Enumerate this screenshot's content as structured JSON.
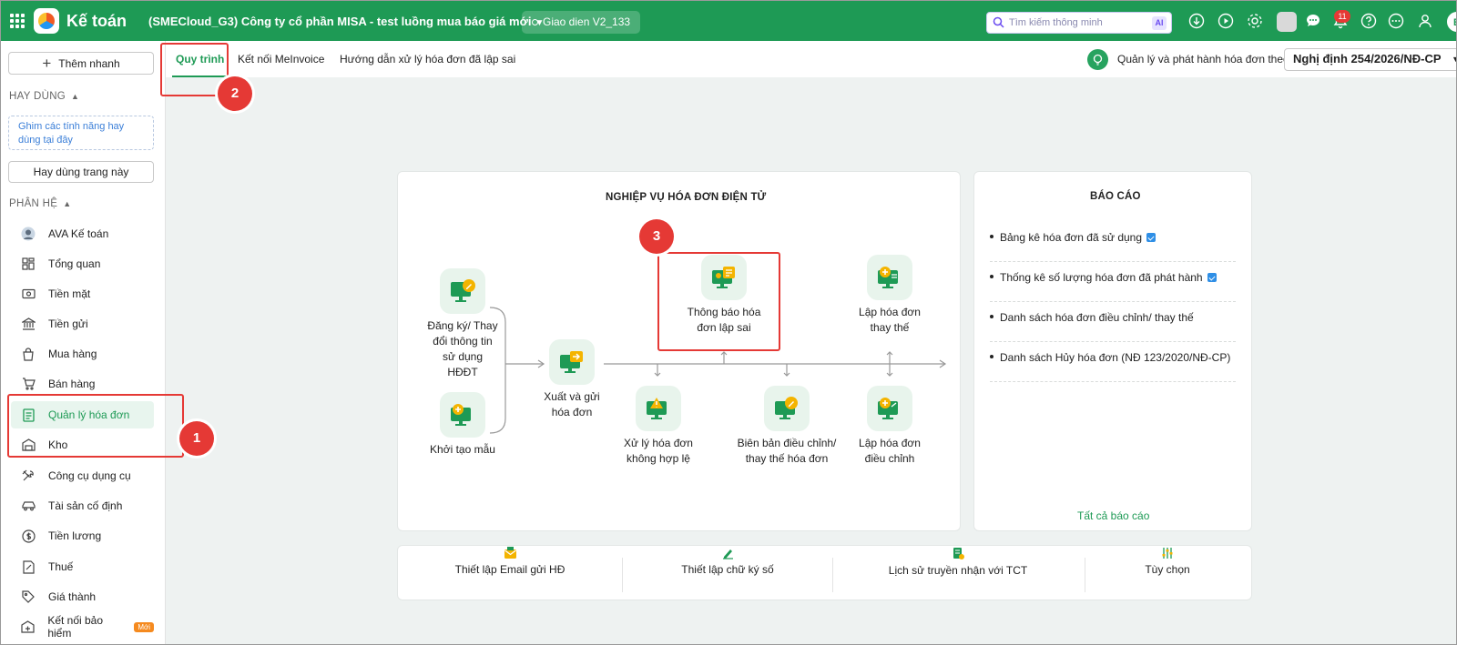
{
  "topbar": {
    "app_title": "Kế toán",
    "company": "(SMECloud_G3) Công ty cổ phần MISA - test luồng mua báo giá mới",
    "theme": "Giao dien V2_133",
    "search_placeholder": "Tìm kiếm thông minh",
    "search_ai": "AI",
    "notification_count": "11",
    "avatar_initial": "B"
  },
  "sidebar": {
    "quick_add": "Thêm nhanh",
    "frequent_title": "HAY DÙNG",
    "pin_hint": "Ghim các tính năng hay dùng tại đây",
    "frequent_button": "Hay dùng trang này",
    "modules_title": "PHÂN HỆ",
    "items": [
      {
        "label": "AVA Kế toán",
        "icon": "ava-avatar-icon"
      },
      {
        "label": "Tổng quan",
        "icon": "dashboard-icon"
      },
      {
        "label": "Tiền mặt",
        "icon": "cash-icon"
      },
      {
        "label": "Tiền gửi",
        "icon": "bank-icon"
      },
      {
        "label": "Mua hàng",
        "icon": "shopping-bag-icon"
      },
      {
        "label": "Bán hàng",
        "icon": "cart-icon"
      },
      {
        "label": "Quản lý hóa đơn",
        "icon": "invoice-icon"
      },
      {
        "label": "Kho",
        "icon": "warehouse-icon"
      },
      {
        "label": "Công cụ dụng cụ",
        "icon": "tools-icon"
      },
      {
        "label": "Tài sản cố định",
        "icon": "car-icon"
      },
      {
        "label": "Tiền lương",
        "icon": "salary-icon"
      },
      {
        "label": "Thuế",
        "icon": "tax-icon"
      },
      {
        "label": "Giá thành",
        "icon": "price-tag-icon"
      },
      {
        "label": "Kết nối bảo hiểm",
        "icon": "insurance-icon",
        "tag": "Mới"
      }
    ]
  },
  "tabs": [
    {
      "label": "Quy trình"
    },
    {
      "label": "Kết nối MeInvoice"
    },
    {
      "label": "Hướng dẫn xử lý hóa đơn đã lập sai"
    }
  ],
  "decree": {
    "label": "Quản lý và phát hành hóa đơn theo:",
    "value": "Nghị định 254/2026/NĐ-CP"
  },
  "workflow": {
    "title": "NGHIỆP VỤ HÓA ĐƠN ĐIỆN TỬ",
    "nodes": {
      "register": "Đăng ký/ Thay đổi thông tin sử dụng HĐĐT",
      "create_template": "Khởi tạo mẫu",
      "issue": "Xuất và gửi hóa đơn",
      "notify_error": "Thông báo hóa đơn lập sai",
      "handle_invalid": "Xử lý hóa đơn không hợp lệ",
      "adjust_minutes": "Biên bản điều chỉnh/ thay thế hóa đơn",
      "replace": "Lập hóa đơn thay thế",
      "adjust": "Lập hóa đơn điều chỉnh"
    }
  },
  "reports": {
    "title": "BÁO CÁO",
    "items": [
      "Bảng kê hóa đơn đã sử dụng",
      "Thống kê số lượng hóa đơn đã phát hành",
      "Danh sách hóa đơn điều chỉnh/ thay thế",
      "Danh sách Hủy hóa đơn (NĐ 123/2020/NĐ-CP)"
    ],
    "all_link": "Tất cả báo cáo"
  },
  "settings": {
    "email": "Thiết lập Email gửi HĐ",
    "signature": "Thiết lập chữ ký số",
    "history": "Lịch sử truyền nhận với TCT",
    "options": "Tùy chọn"
  },
  "annotations": [
    "1",
    "2",
    "3"
  ],
  "colors": {
    "brand": "#1e9a55",
    "annotation": "#e53935"
  }
}
